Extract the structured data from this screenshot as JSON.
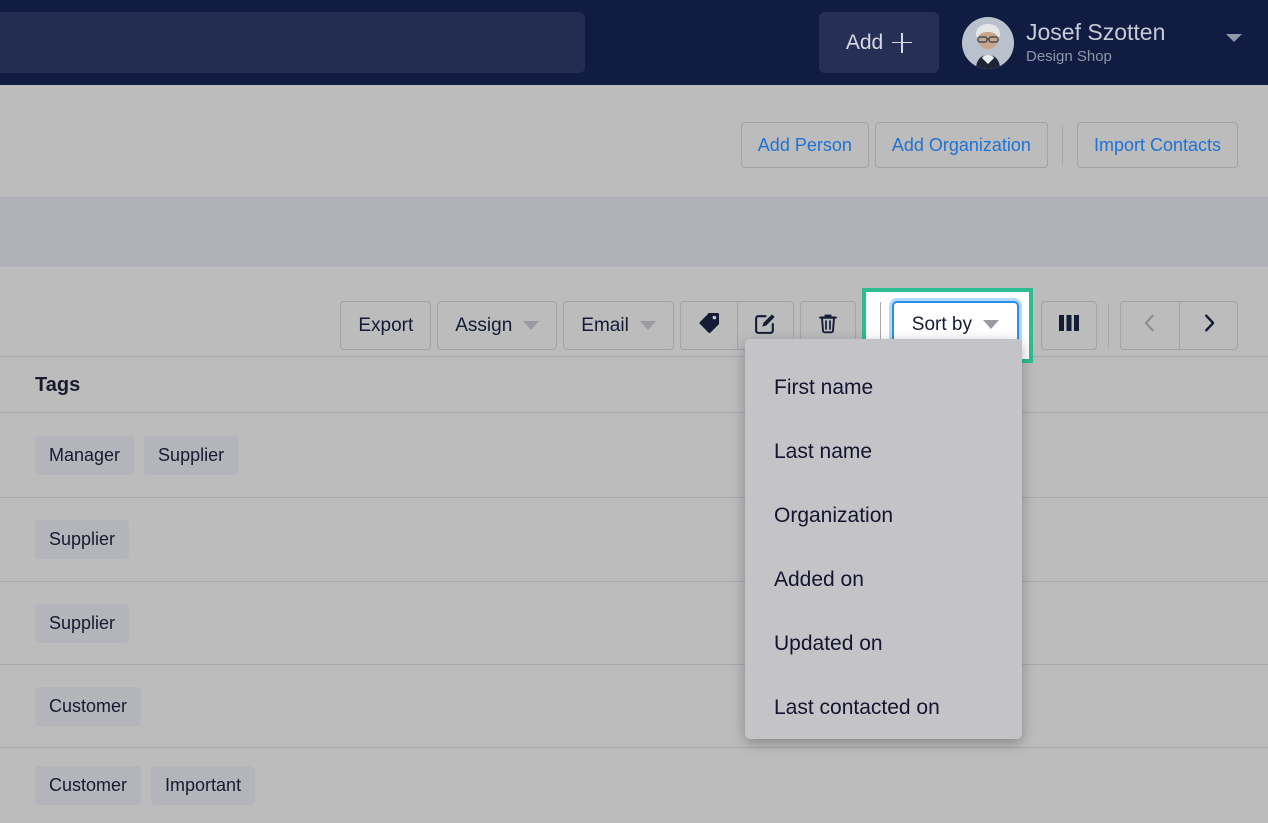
{
  "topbar": {
    "search_placeholder": "",
    "add_button": {
      "label": "Add",
      "icon": "plus-icon"
    },
    "user": {
      "name": "Josef Szotten",
      "org": "Design Shop"
    },
    "bg_color": "#111c42",
    "caret_icon": "chevron-down-icon"
  },
  "subheader": {
    "buttons": [
      {
        "label": "Add Person",
        "name": "add-person-button"
      },
      {
        "label": "Add Organization",
        "name": "add-organization-button"
      }
    ],
    "import_label": "Import Contacts",
    "link_color": "#1f72d4"
  },
  "toolbar": {
    "export_label": "Export",
    "assign_label": "Assign",
    "email_label": "Email",
    "tag_icon": "tag-icon",
    "edit_icon": "edit-pencil-icon",
    "delete_icon": "trash-icon",
    "sort_by_label": "Sort by",
    "columns_icon": "columns-icon",
    "prev_icon": "chevron-left-icon",
    "next_icon": "chevron-right-icon",
    "highlight_color": "#2ebd92",
    "focus_color": "#2a8fec"
  },
  "sort_menu": {
    "items": [
      {
        "label": "First name"
      },
      {
        "label": "Last name"
      },
      {
        "label": "Organization"
      },
      {
        "label": "Added on"
      },
      {
        "label": "Updated on"
      },
      {
        "label": "Last contacted on"
      }
    ]
  },
  "table": {
    "column_header": "Tags",
    "rows": [
      {
        "tags": [
          "Manager",
          "Supplier"
        ]
      },
      {
        "tags": [
          "Supplier"
        ]
      },
      {
        "tags": [
          "Supplier"
        ]
      },
      {
        "tags": [
          "Customer"
        ]
      },
      {
        "tags": [
          "Customer",
          "Important"
        ]
      }
    ]
  }
}
